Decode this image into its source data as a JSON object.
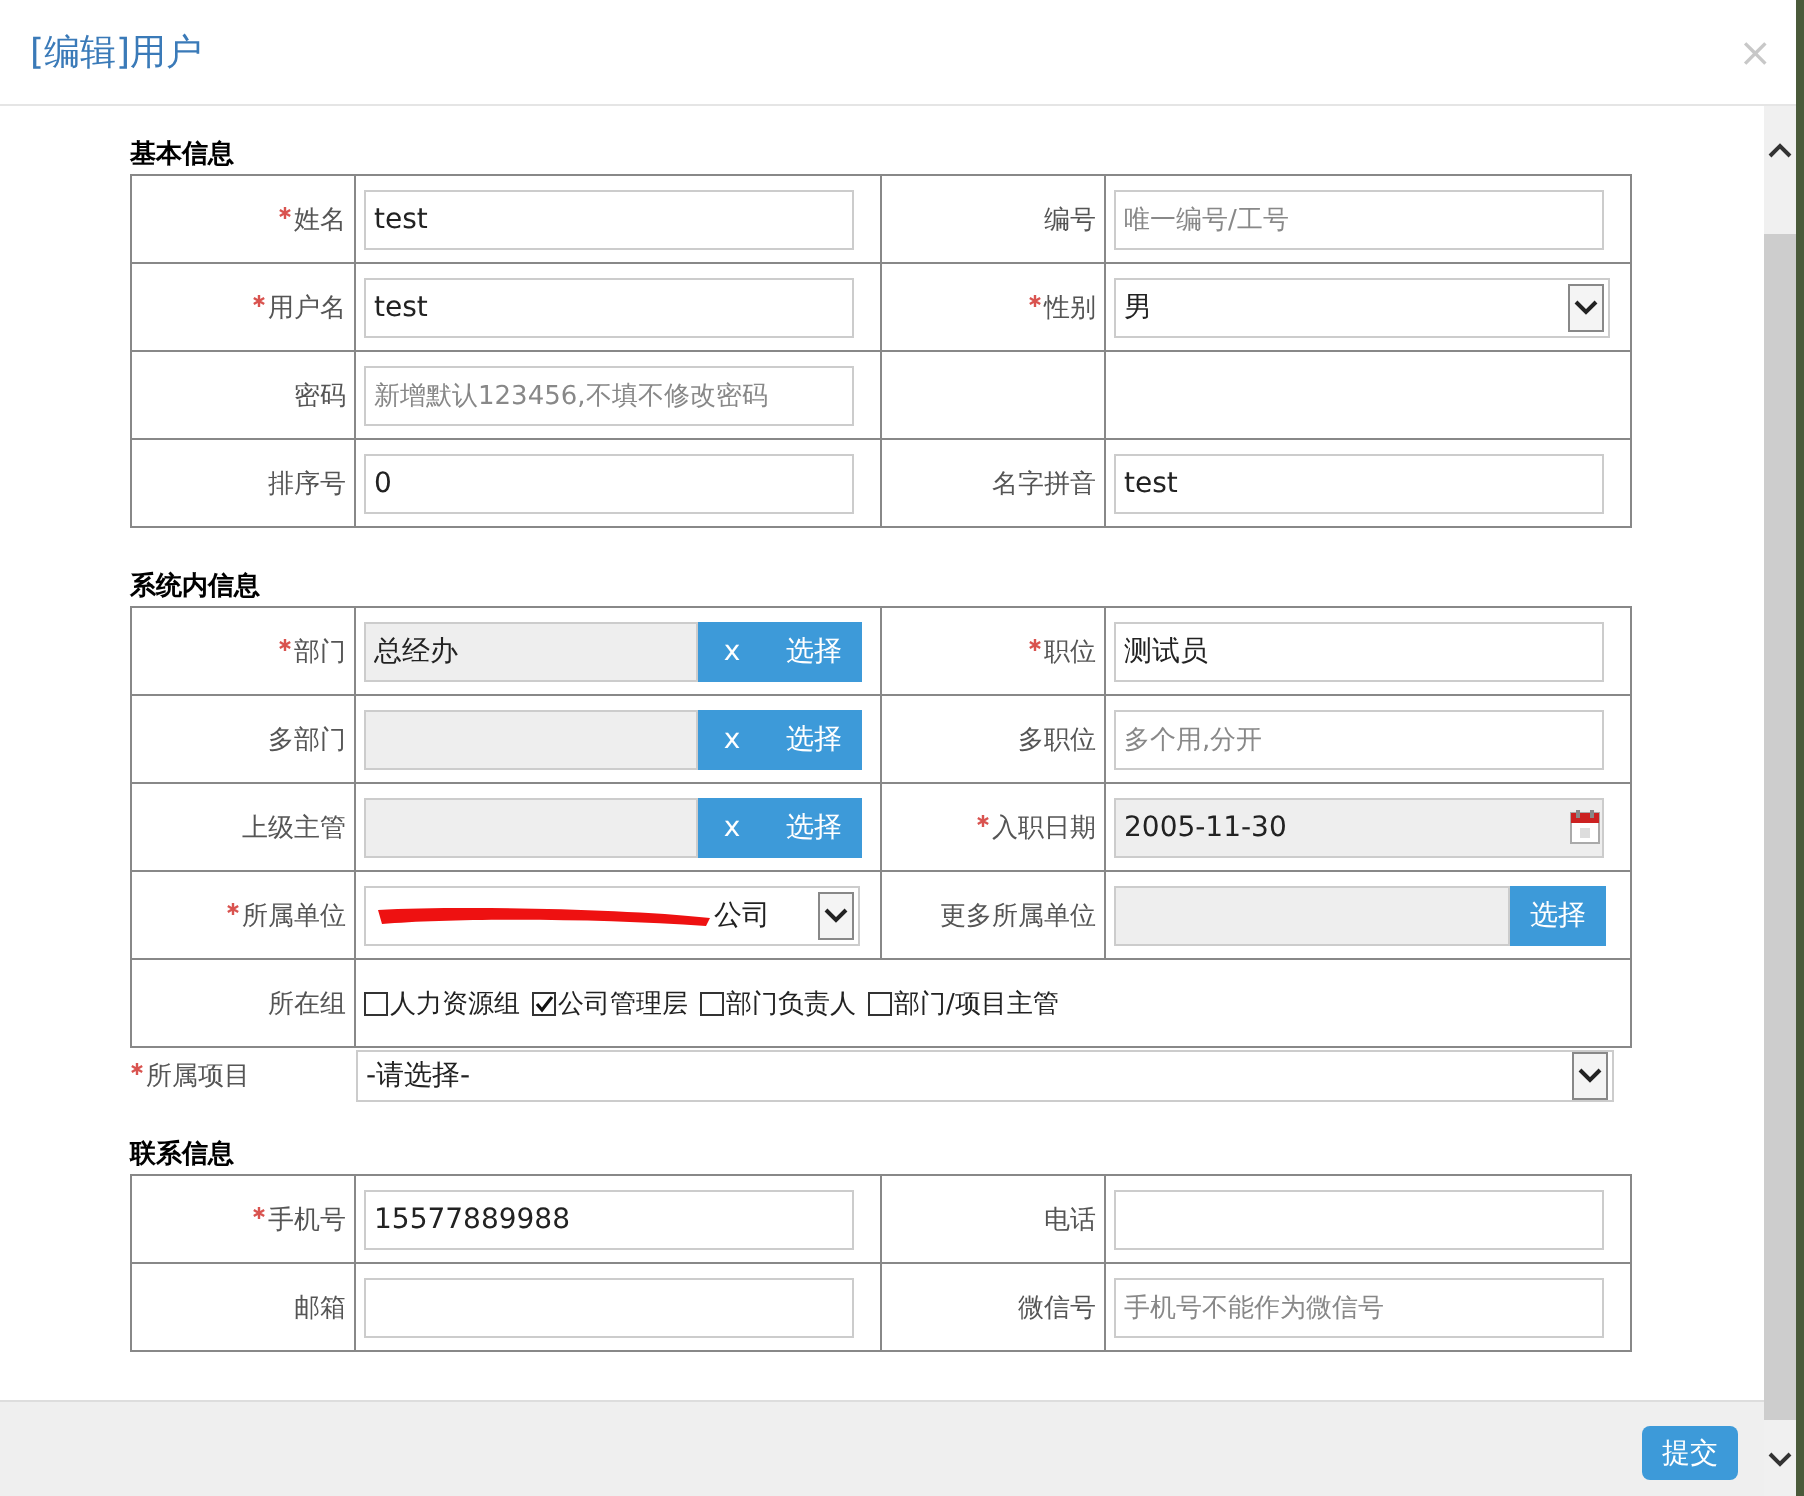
{
  "window": {
    "title": "[编辑]用户",
    "close": "×"
  },
  "sections": [
    {
      "title": "基本信息",
      "rows": [
        {
          "cells": [
            {
              "label": "姓名",
              "required": true,
              "field": {
                "kind": "text",
                "value": "test"
              }
            },
            {
              "label": "编号",
              "required": false,
              "field": {
                "kind": "text",
                "placeholder": "唯一编号/工号"
              }
            }
          ]
        },
        {
          "cells": [
            {
              "label": "用户名",
              "required": true,
              "field": {
                "kind": "text",
                "value": "test"
              }
            },
            {
              "label": "性别",
              "required": true,
              "field": {
                "kind": "select",
                "value": "男"
              }
            }
          ]
        },
        {
          "cells": [
            {
              "label": "密码",
              "required": false,
              "field": {
                "kind": "text",
                "placeholder": "新增默认123456,不填不修改密码"
              }
            },
            {
              "field": {
                "kind": "empty"
              }
            }
          ]
        },
        {
          "cells": [
            {
              "label": "排序号",
              "required": false,
              "field": {
                "kind": "text",
                "value": "0"
              }
            },
            {
              "label": "名字拼音",
              "required": false,
              "field": {
                "kind": "text",
                "value": "test"
              }
            }
          ]
        }
      ]
    },
    {
      "title": "系统内信息",
      "rows": [
        {
          "cells": [
            {
              "label": "部门",
              "required": true,
              "field": {
                "kind": "picker",
                "value": "总经办",
                "clear": "x",
                "button": "选择"
              }
            },
            {
              "label": "职位",
              "required": true,
              "field": {
                "kind": "text",
                "value": "测试员"
              }
            }
          ]
        },
        {
          "cells": [
            {
              "label": "多部门",
              "required": false,
              "field": {
                "kind": "picker",
                "clear": "x",
                "button": "选择"
              }
            },
            {
              "label": "多职位",
              "required": false,
              "field": {
                "kind": "text",
                "placeholder": "多个用,分开"
              }
            }
          ]
        },
        {
          "cells": [
            {
              "label": "上级主管",
              "required": false,
              "field": {
                "kind": "picker",
                "clear": "x",
                "button": "选择"
              }
            },
            {
              "label": "入职日期",
              "required": true,
              "field": {
                "kind": "date",
                "value": "2005-11-30"
              }
            }
          ]
        },
        {
          "cells": [
            {
              "label": "所属单位",
              "required": true,
              "field": {
                "kind": "select",
                "value": "公司",
                "redacted": true
              }
            },
            {
              "label": "更多所属单位",
              "required": false,
              "field": {
                "kind": "chooser",
                "button": "选择"
              }
            }
          ]
        },
        {
          "cells": [
            {
              "label": "所在组",
              "required": false,
              "field": {
                "kind": "checks",
                "options": [
                  {
                    "label": "人力资源组",
                    "checked": false
                  },
                  {
                    "label": "公司管理层",
                    "checked": true
                  },
                  {
                    "label": "部门负责人",
                    "checked": false
                  },
                  {
                    "label": "部门/项目主管",
                    "checked": false
                  }
                ]
              }
            }
          ]
        }
      ],
      "extra": {
        "label": "所属项目",
        "required": true,
        "field": {
          "kind": "select",
          "value": "-请选择-"
        }
      }
    },
    {
      "title": "联系信息",
      "rows": [
        {
          "cells": [
            {
              "label": "手机号",
              "required": true,
              "field": {
                "kind": "text",
                "value": "15577889988"
              }
            },
            {
              "label": "电话",
              "required": false,
              "field": {
                "kind": "text"
              }
            }
          ]
        },
        {
          "cells": [
            {
              "label": "邮箱",
              "required": false,
              "field": {
                "kind": "text"
              }
            },
            {
              "label": "微信号",
              "required": false,
              "field": {
                "kind": "text",
                "placeholder": "手机号不能作为微信号"
              }
            }
          ]
        }
      ]
    }
  ],
  "footer": {
    "submit": "提交"
  }
}
